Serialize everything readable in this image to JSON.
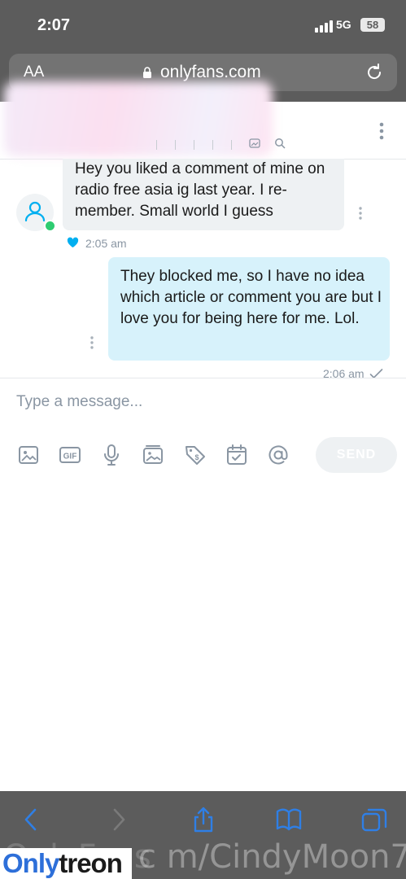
{
  "status_bar": {
    "time": "2:07",
    "network": "5G",
    "battery": "58"
  },
  "browser": {
    "text_size_label": "AA",
    "url": "onlyfans.com"
  },
  "messages": [
    {
      "direction": "incoming",
      "text": "Hey you liked a comment of mine on radio free asia ig last year. I re-member. Small world I guess",
      "time": "2:05 am",
      "liked": true
    },
    {
      "direction": "outgoing",
      "text": "They blocked me, so I have no idea which article or comment you are but I love you for being here for me. Lol.",
      "time": "2:06 am",
      "status": "sent"
    }
  ],
  "composer": {
    "placeholder": "Type a message...",
    "tools": [
      "image-icon",
      "gif-icon",
      "microphone-icon",
      "media-vault-icon",
      "price-tag-icon",
      "calendar-icon",
      "mention-icon"
    ],
    "send_label": "SEND"
  },
  "watermark": {
    "logo_part1": "Only",
    "logo_part2": "treon",
    "url_text": "c m/CindyMoon7",
    "faint_text": "OnlyFans"
  },
  "colors": {
    "accent": "#00aff0",
    "online": "#2ecc71",
    "outgoing_bubble": "#d7f2fb",
    "incoming_bubble": "#eef1f3",
    "ios_blue": "#2f7fe5"
  }
}
